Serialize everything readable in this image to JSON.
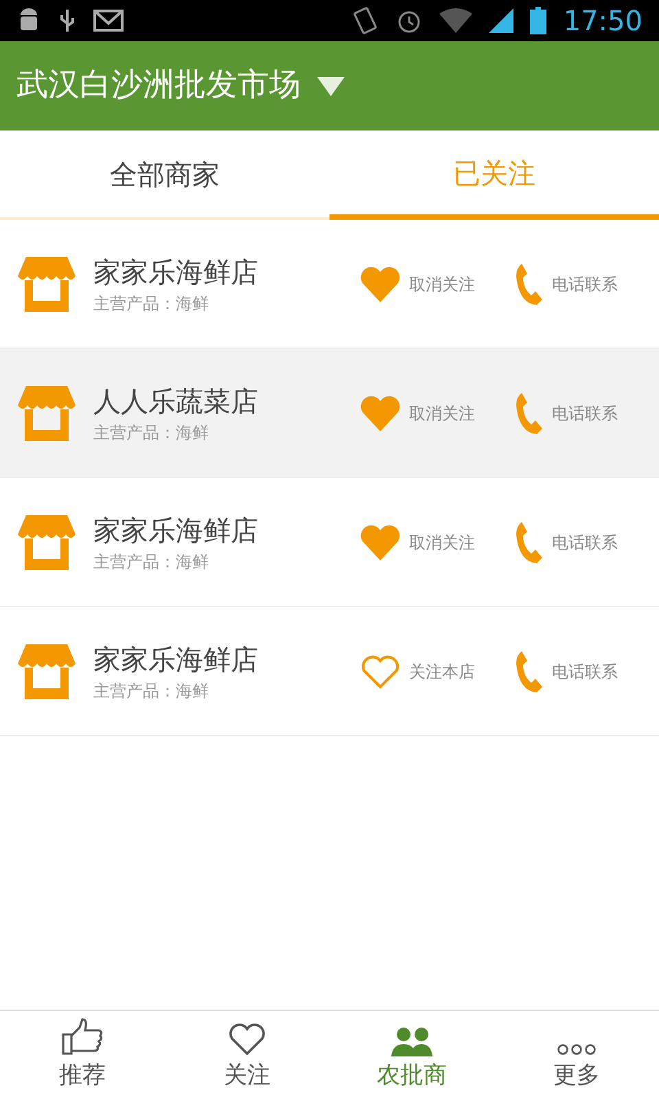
{
  "status_bar": {
    "time": "17:50"
  },
  "header": {
    "title": "武汉白沙洲批发市场"
  },
  "tabs": [
    {
      "label": "全部商家",
      "selected": false
    },
    {
      "label": "已关注",
      "selected": true
    }
  ],
  "shops": [
    {
      "name": "家家乐海鲜店",
      "products": "主营产品：海鲜",
      "followed": true,
      "follow_label": "取消关注",
      "call_label": "电话联系",
      "selected": false
    },
    {
      "name": "人人乐蔬菜店",
      "products": "主营产品：海鲜",
      "followed": true,
      "follow_label": "取消关注",
      "call_label": "电话联系",
      "selected": true
    },
    {
      "name": "家家乐海鲜店",
      "products": "主营产品：海鲜",
      "followed": true,
      "follow_label": "取消关注",
      "call_label": "电话联系",
      "selected": false
    },
    {
      "name": "家家乐海鲜店",
      "products": "主营产品：海鲜",
      "followed": false,
      "follow_label": "关注本店",
      "call_label": "电话联系",
      "selected": false
    }
  ],
  "bottom_nav": [
    {
      "label": "推荐",
      "kind": "thumb",
      "selected": false
    },
    {
      "label": "关注",
      "kind": "heart",
      "selected": false
    },
    {
      "label": "农批商",
      "kind": "people",
      "selected": true
    },
    {
      "label": "更多",
      "kind": "more",
      "selected": false
    }
  ]
}
